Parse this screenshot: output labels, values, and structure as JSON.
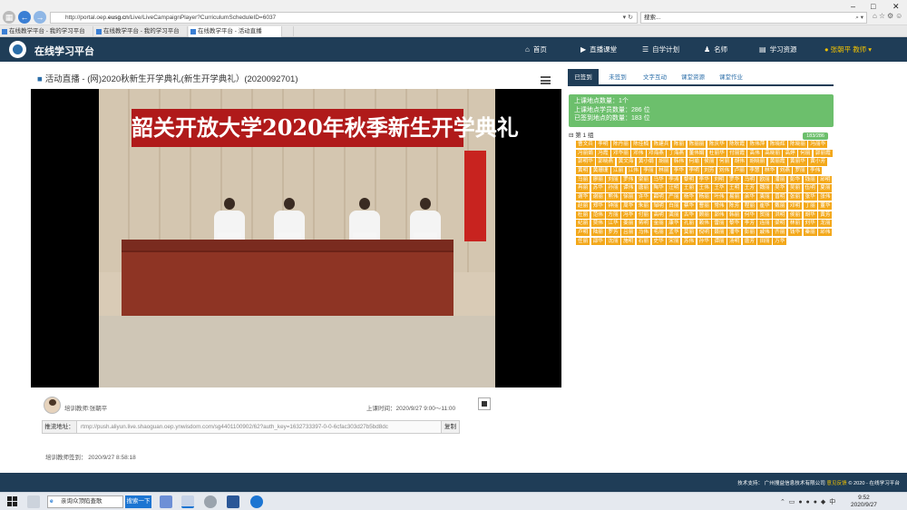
{
  "browser": {
    "url_prefix": "http://portal.oep.",
    "url_domain": "eusg.cn",
    "url_suffix": "/Live/LiveCampaignPlayer?CurriculumScheduleID=6037",
    "search_value": "搜索...",
    "tabs": [
      "在线教学平台 - 我的学习平台",
      "在线教学平台 - 我的学习平台",
      "在线教学平台 - 活动直播"
    ]
  },
  "header": {
    "site_title": "在线学习平台",
    "nav": [
      {
        "label": "首页",
        "icon": "home-icon",
        "glyph": "⌂"
      },
      {
        "label": "直播课堂",
        "icon": "video-icon",
        "glyph": "▶"
      },
      {
        "label": "自学计划",
        "icon": "plan-icon",
        "glyph": "☰"
      },
      {
        "label": "名师",
        "icon": "teacher-icon",
        "glyph": "♟"
      },
      {
        "label": "学习资源",
        "icon": "book-icon",
        "glyph": "▤"
      }
    ],
    "user": "张朝平 教师 ▾"
  },
  "lesson": {
    "title": "活动直播 - (网)2020秋新生开学典礼(新生开学典礼）(2020092701)",
    "banner_text": "韶关开放大学2020年秋季新生开学典礼",
    "trainer": "培训教师:张朝平",
    "class_time": "上课时间：2020/9/27 9:00～11:00",
    "push_label": "推流地址：",
    "push_url": "rtmp://push.aliyun.live.shaoguan.oep.ynwisdom.com/sg4401100902/62?auth_key=1632733397-0-0-6cfac303d27b5bd8dc",
    "copy_label": "复制",
    "signin": "培训教师签到：   2020/9/27 8:58:18"
  },
  "panel": {
    "tabs": [
      "已签到",
      "未签到",
      "文字互动",
      "课堂资源",
      "课堂作业"
    ],
    "stats": [
      "上课地点数量：1个",
      "上课地点学员数量：286 位",
      "已签到地点的数量：183 位"
    ],
    "group": "⊟ 第 1 组",
    "group_count": "183/286",
    "names": [
      "曹文兵",
      "李明",
      "陈丹丽",
      "陈佳楠",
      "陈建兵",
      "陈丽",
      "陈丽丽",
      "陈庆华",
      "陈秋霞",
      "陈伟萍",
      "陈晓辉",
      "陈晓丽",
      "冯丽华",
      "冯丽娟",
      "冯霞",
      "邓华丽",
      "邓伟",
      "邓海燕",
      "丁海燕",
      "董伟娟",
      "杜丽华",
      "付丽霞",
      "高伟",
      "高晓丽",
      "高婷",
      "何丽",
      "郭丽霞",
      "郭明华",
      "郭晓燕",
      "黄文海",
      "黄小娟",
      "胡丽",
      "韩伟",
      "何瑜",
      "侯丽",
      "何丽",
      "胡伟",
      "胡晓丽",
      "黄丽霞",
      "黄丽华",
      "黄小芳",
      "黄明",
      "黄珊珊",
      "江丽",
      "江伟",
      "李丽",
      "林丽",
      "李华",
      "李明",
      "刘芳",
      "刘伟",
      "卢丽",
      "李慧",
      "林华",
      "刘燕",
      "罗丽",
      "李伟",
      "马丽",
      "廖丽",
      "刘丽",
      "罗伟",
      "梁丽",
      "马华",
      "李涛",
      "黎明",
      "李华",
      "刘明",
      "罗华",
      "马明",
      "欧丽",
      "潘丽",
      "彭华",
      "钱丽",
      "邱明",
      "冉丽",
      "苏华",
      "孙丽",
      "谭伟",
      "唐丽",
      "陶华",
      "汪明",
      "王丽",
      "王伟",
      "王华",
      "王明",
      "王芳",
      "魏丽",
      "吴华",
      "吴丽",
      "伍明",
      "夏丽",
      "谢华",
      "谢丽",
      "熊伟",
      "徐丽",
      "许华",
      "薛明",
      "严丽",
      "杨华",
      "杨丽",
      "叶伟",
      "易丽",
      "余华",
      "袁丽",
      "曾明",
      "张丽",
      "张华",
      "张伟",
      "赵丽",
      "郑华",
      "钟丽",
      "周华",
      "朱丽",
      "邹明",
      "白丽",
      "蔡华",
      "曹丽",
      "常伟",
      "陈芳",
      "程丽",
      "崔华",
      "戴丽",
      "邓明",
      "丁丽",
      "董华",
      "杜丽",
      "范伟",
      "方丽",
      "冯华",
      "付丽",
      "高明",
      "龚丽",
      "古华",
      "顾丽",
      "郭伟",
      "韩丽",
      "何华",
      "贺丽",
      "洪明",
      "侯丽",
      "胡华",
      "黄芳",
      "纪丽",
      "贾伟",
      "江华",
      "姜丽",
      "蒋明",
      "金丽",
      "康华",
      "孔丽",
      "赖伟",
      "雷丽",
      "黎华",
      "李芳",
      "连丽",
      "梁明",
      "林丽",
      "刘华",
      "龙丽",
      "卢明",
      "陆丽",
      "罗芳",
      "吕丽",
      "马伟",
      "毛丽",
      "孟华",
      "莫丽",
      "倪明",
      "聂丽",
      "潘华",
      "彭丽",
      "戚伟",
      "齐丽",
      "钱华",
      "秦丽",
      "邱伟",
      "任丽",
      "邵华",
      "沈丽",
      "施明",
      "石丽",
      "史华",
      "宋丽",
      "苏伟",
      "孙华",
      "谭丽",
      "汤明",
      "唐芳",
      "田丽",
      "万华"
    ]
  },
  "footer": {
    "support_label": "技术支持：",
    "company": "广州搜益信息技术有限公司",
    "feedback": "意见反馈",
    "copyright": "© 2020 - 在线学习平台"
  },
  "taskbar": {
    "search_text": "亲询众顶陷查歌",
    "go_label": "搜索一下",
    "time": "9:52",
    "date": "2020/9/27",
    "ime": "中"
  },
  "colors": {
    "header_bg": "#1f3d57",
    "accent_orange": "#f3a81a",
    "stats_green": "#6cbf6c",
    "user_gold": "#f2c200"
  }
}
